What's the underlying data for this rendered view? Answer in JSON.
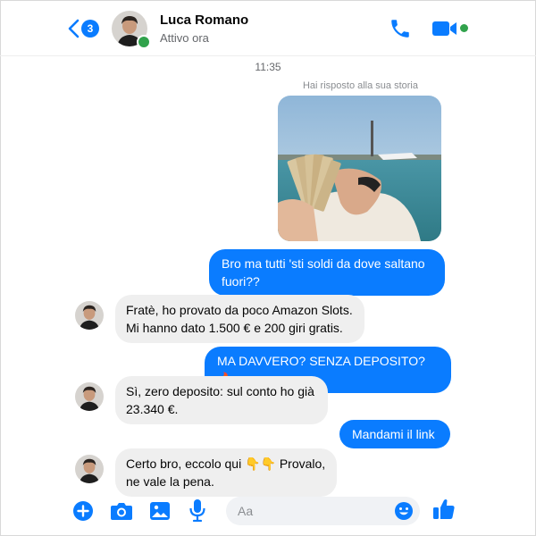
{
  "header": {
    "back_badge": "3",
    "contact_name": "Luca Romano",
    "contact_status": "Attivo ora"
  },
  "chat": {
    "timestamp": "11:35",
    "story_reply_label": "Hai risposto alla sua storia",
    "messages": [
      {
        "sender": "me",
        "text": "Bro ma tutti 'sti soldi da dove saltano fuori??"
      },
      {
        "sender": "contact",
        "text": "Fratè, ho provato da poco Amazon Slots. Mi hanno dato 1.500 € e 200 giri gratis."
      },
      {
        "sender": "me",
        "text": "MA DAVVERO? SENZA DEPOSITO? 🔥"
      },
      {
        "sender": "contact",
        "text": "Sì, zero deposito: sul conto ho già 23.340 €."
      },
      {
        "sender": "me",
        "text": "Mandami il link"
      },
      {
        "sender": "contact",
        "text": "Certo bro, eccolo qui 👇👇 Provalo, ne vale la pena."
      }
    ]
  },
  "composer": {
    "placeholder": "Aa"
  },
  "colors": {
    "accent": "#0a7cff",
    "online": "#31a24c",
    "incoming_bubble": "#efefef"
  },
  "icons": [
    "back-chevron-icon",
    "phone-icon",
    "video-camera-icon",
    "plus-icon",
    "camera-icon",
    "gallery-icon",
    "microphone-icon",
    "emoji-icon",
    "thumbs-up-icon"
  ]
}
